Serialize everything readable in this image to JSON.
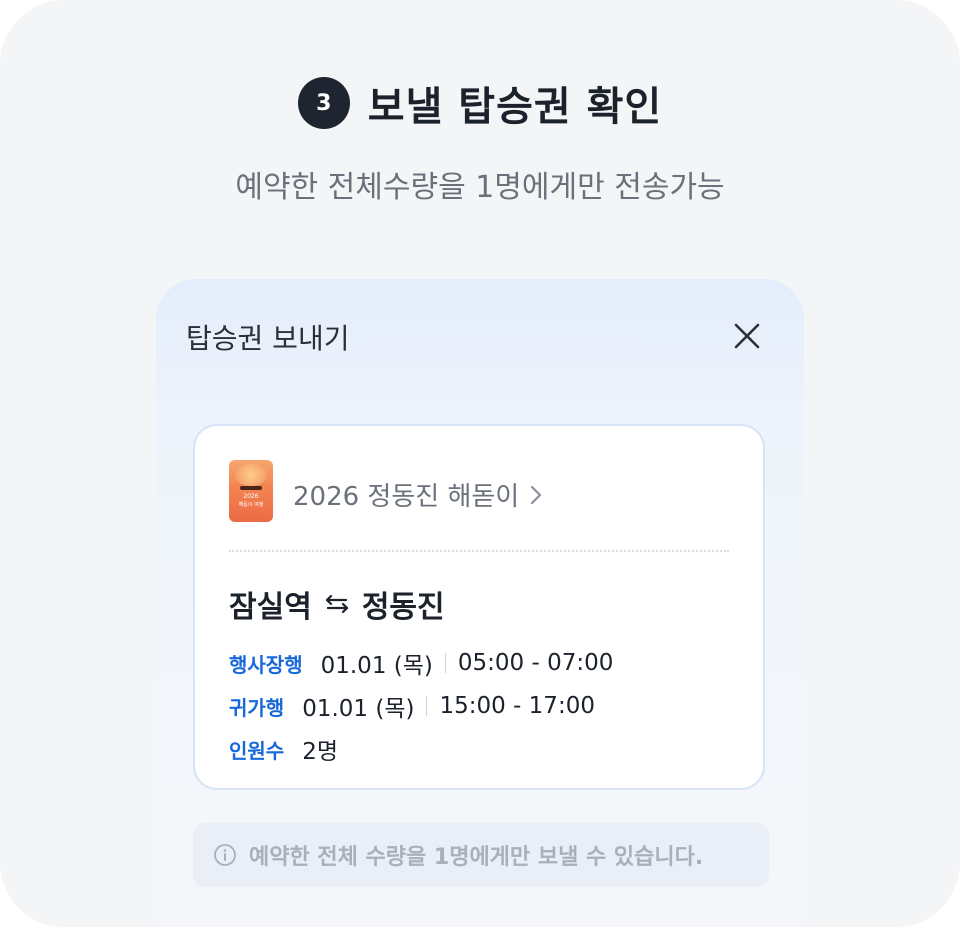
{
  "step": {
    "number": "3",
    "title": "보낼 탑승권 확인",
    "subtitle": "예약한 전체수량을 1명에게만 전송가능"
  },
  "sheet": {
    "title": "탑승권 보내기"
  },
  "card": {
    "poster": {
      "year": "2026",
      "line": "해돋이 여행"
    },
    "event_name": "2026 정동진 해돋이",
    "route": {
      "from": "잠실역",
      "to": "정동진"
    },
    "rows": [
      {
        "label": "행사장행",
        "date": "01.01 (목)",
        "time": "05:00 - 07:00"
      },
      {
        "label": "귀가행",
        "date": "01.01 (목)",
        "time": "15:00 - 17:00"
      },
      {
        "label": "인원수",
        "value": "2명"
      }
    ]
  },
  "notice": {
    "text": "예약한 전체 수량을 1명에게만 보낼 수 있습니다."
  },
  "colors": {
    "accent": "#1768d9",
    "dark": "#1f2530",
    "background": "#f4f5f7"
  }
}
